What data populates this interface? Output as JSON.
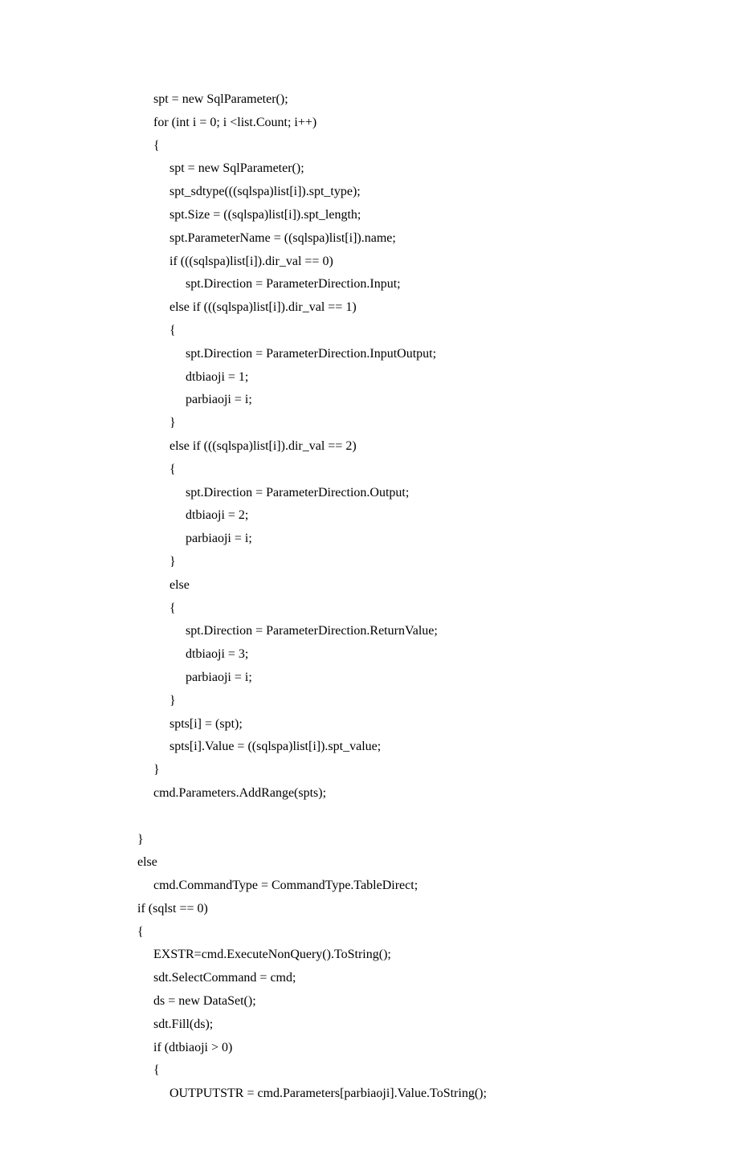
{
  "code_lines": [
    "         spt = new SqlParameter();",
    "         for (int i = 0; i <list.Count; i++)",
    "         {",
    "              spt = new SqlParameter();",
    "              spt_sdtype(((sqlspa)list[i]).spt_type);",
    "              spt.Size = ((sqlspa)list[i]).spt_length;",
    "              spt.ParameterName = ((sqlspa)list[i]).name;",
    "              if (((sqlspa)list[i]).dir_val == 0)",
    "                   spt.Direction = ParameterDirection.Input;",
    "              else if (((sqlspa)list[i]).dir_val == 1)",
    "              {",
    "                   spt.Direction = ParameterDirection.InputOutput;",
    "                   dtbiaoji = 1;",
    "                   parbiaoji = i;",
    "              }",
    "              else if (((sqlspa)list[i]).dir_val == 2)",
    "              {",
    "                   spt.Direction = ParameterDirection.Output;",
    "                   dtbiaoji = 2;",
    "                   parbiaoji = i;",
    "              }",
    "              else",
    "              {",
    "                   spt.Direction = ParameterDirection.ReturnValue;",
    "                   dtbiaoji = 3;",
    "                   parbiaoji = i;",
    "              }",
    "              spts[i] = (spt);",
    "              spts[i].Value = ((sqlspa)list[i]).spt_value;",
    "         }",
    "         cmd.Parameters.AddRange(spts);",
    "",
    "    }",
    "    else",
    "         cmd.CommandType = CommandType.TableDirect;",
    "    if (sqlst == 0)",
    "    {",
    "         EXSTR=cmd.ExecuteNonQuery().ToString();",
    "         sdt.SelectCommand = cmd;",
    "         ds = new DataSet();",
    "         sdt.Fill(ds);",
    "         if (dtbiaoji > 0)",
    "         {",
    "              OUTPUTSTR = cmd.Parameters[parbiaoji].Value.ToString();"
  ]
}
